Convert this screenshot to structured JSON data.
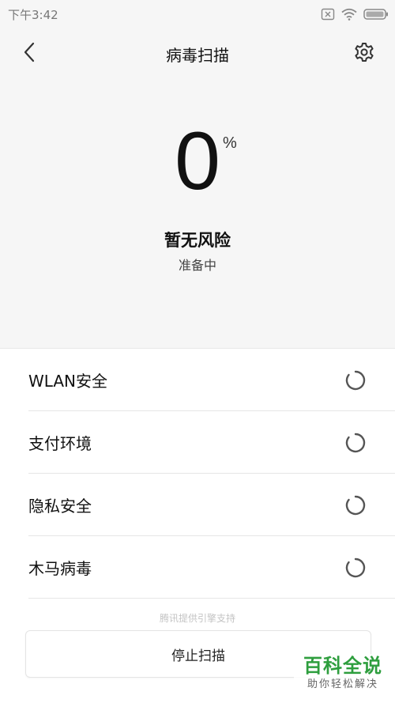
{
  "status_bar": {
    "time": "下午3:42",
    "icons": [
      "sim-card-icon",
      "wifi-icon",
      "battery-icon"
    ]
  },
  "header": {
    "title": "病毒扫描",
    "back_icon": "chevron-left-icon",
    "settings_icon": "gear-icon"
  },
  "progress": {
    "value": "0",
    "unit": "%",
    "risk_status": "暂无风险",
    "state": "准备中"
  },
  "scan_items": [
    {
      "label": "WLAN安全",
      "icon": "spinner-icon"
    },
    {
      "label": "支付环境",
      "icon": "spinner-icon"
    },
    {
      "label": "隐私安全",
      "icon": "spinner-icon"
    },
    {
      "label": "木马病毒",
      "icon": "spinner-icon"
    }
  ],
  "footer": {
    "provider_note": "腾讯提供引擎支持",
    "stop_button_label": "停止扫描"
  },
  "watermark": {
    "title": "百科全说",
    "subtitle": "助你轻松解决"
  },
  "colors": {
    "top_background": "#f6f6f6",
    "watermark_green": "#2e9e3e",
    "spinner": "#555555"
  }
}
